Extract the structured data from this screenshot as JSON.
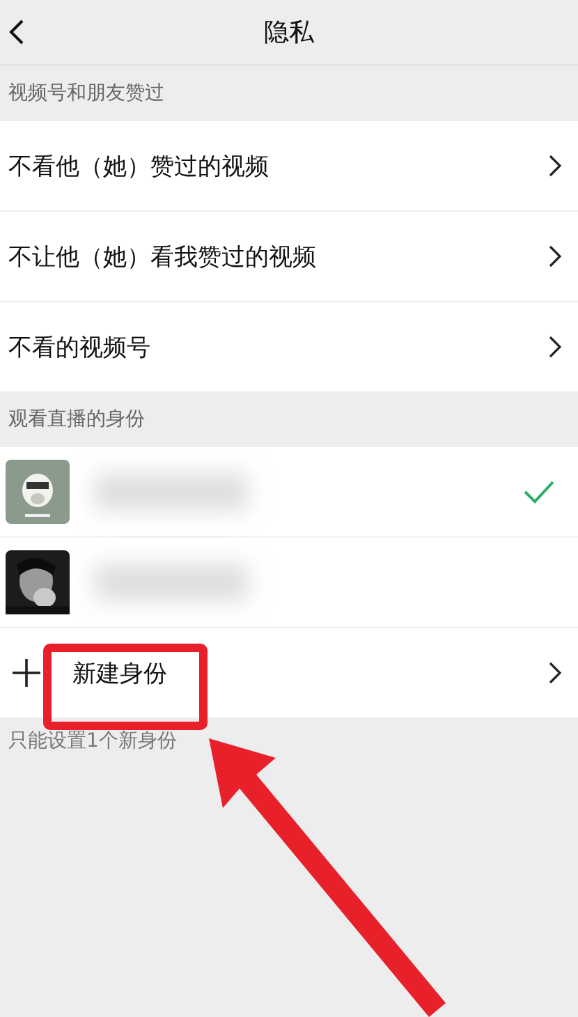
{
  "header": {
    "title": "隐私"
  },
  "sections": [
    {
      "label": "视频号和朋友赞过",
      "rows": [
        {
          "label": "不看他（她）赞过的视频"
        },
        {
          "label": "不让他（她）看我赞过的视频"
        },
        {
          "label": "不看的视频号"
        }
      ]
    }
  ],
  "identity": {
    "label": "观看直播的身份",
    "items": [
      {
        "kind": "picture",
        "selected": true
      },
      {
        "kind": "picture",
        "selected": false
      }
    ],
    "new_label": "新建身份",
    "hint": "只能设置1个新身份"
  }
}
